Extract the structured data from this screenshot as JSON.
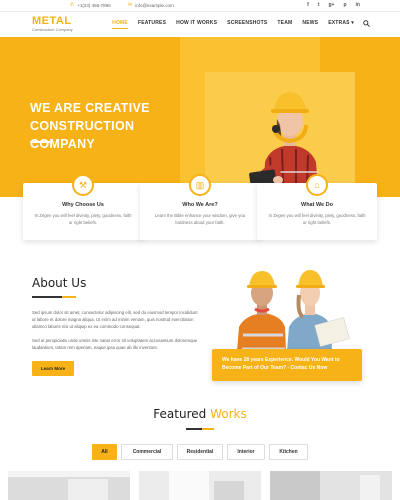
{
  "topbar": {
    "phone": "+1(23) 456-7890",
    "email": "info@example.com",
    "socials": [
      "f",
      "t",
      "g+",
      "p",
      "in"
    ]
  },
  "nav": {
    "logo_text": "METAL",
    "logo_tagline": "Construction Company",
    "items": [
      "HOME",
      "FEATURES",
      "HOW IT WORKS",
      "SCREENSHOTS",
      "TEAM",
      "NEWS",
      "EXTRAS"
    ],
    "extras_caret": "▾",
    "search_icon": "search-icon"
  },
  "hero": {
    "headline_line1": "WE ARE CREATIVE",
    "headline_line2": "CONSTRUCTION COMPANY"
  },
  "cards": [
    {
      "icon": "tools-icon",
      "glyph": "⚒",
      "title": "Why Choose Us",
      "desc": "In Zegen you will feel divinity, piety, goodness, faith or right beliefs."
    },
    {
      "icon": "book-icon",
      "glyph": "▥",
      "title": "Who We Are?",
      "desc": "Learn the Bible enhance your wisdom, give you boldness about your faith."
    },
    {
      "icon": "house-icon",
      "glyph": "⌂",
      "title": "What We Do",
      "desc": "In Zegen you will feel divinity, piety, goodness, faith or right beliefs."
    }
  ],
  "about": {
    "title": "About Us",
    "para1": "Sed ipsum dolor sit amet, consectetur adipiscing elit, sed do eiusmod tempor incididunt ut labore et dolore magna aliqua. Ut enim ad minim veniam, quis nostrud exercitation ullamco laboris nisi ut aliquip ex ea commodo consequat.",
    "para2": "Sed ut perspiciatis unde omnis iste natus error sit voluptatem accusantium doloremque laudantium, totam rem aperiam, eaque ipsa quae ab illo inventore.",
    "button": "Learn More",
    "callout": "We have 28 years Experience. Would You Want to Become Part of Our Team? - Contac Us Now"
  },
  "featured": {
    "title_plain": "Featured",
    "title_accent": "Works",
    "filters": [
      "All",
      "Commercial",
      "Residential",
      "Interior",
      "Kitchen"
    ],
    "active_filter": "All"
  },
  "colors": {
    "accent": "#f7b217",
    "text": "#333333"
  }
}
